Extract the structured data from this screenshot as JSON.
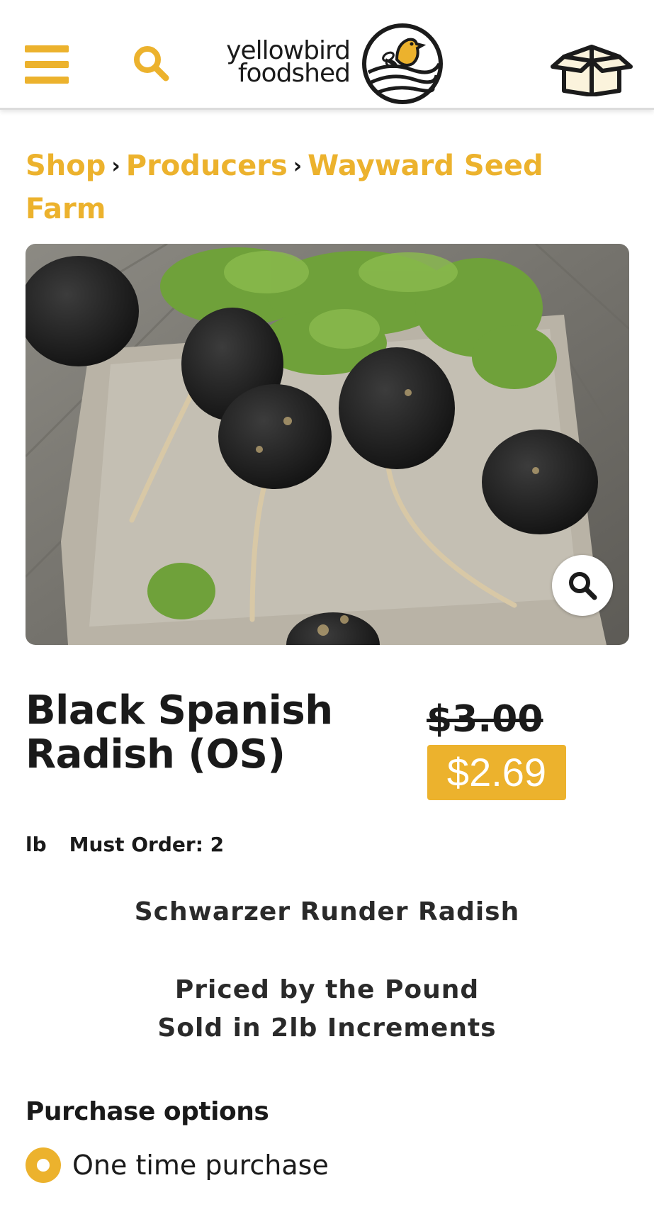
{
  "header": {
    "menu_icon": "hamburger-menu-icon",
    "search_icon": "search-icon",
    "logo": {
      "line1": "yellowbird",
      "line2": "foodshed",
      "badge_icon": "bird-badge-icon"
    },
    "cart_icon": "box-cart-icon"
  },
  "breadcrumb": {
    "items": [
      "Shop",
      "Producers",
      "Wayward Seed Farm"
    ],
    "separator": "›"
  },
  "product": {
    "image_alt": "Black Spanish radishes on linen",
    "zoom_icon": "zoom-search-icon",
    "title_line1": "Black Spanish",
    "title_line2": "Radish (OS)",
    "old_price": "$3.00",
    "sale_price": "$2.69",
    "unit": "lb",
    "must_order": "Must Order: 2",
    "subtitle": "Schwarzer Runder Radish",
    "note_line1": "Priced by the Pound",
    "note_line2": "Sold in 2lb Increments"
  },
  "purchase": {
    "heading": "Purchase options",
    "options": [
      {
        "label": "One time purchase",
        "selected": true
      }
    ]
  },
  "colors": {
    "accent": "#ecb22d",
    "text": "#1a1a1a",
    "background": "#ffffff"
  }
}
